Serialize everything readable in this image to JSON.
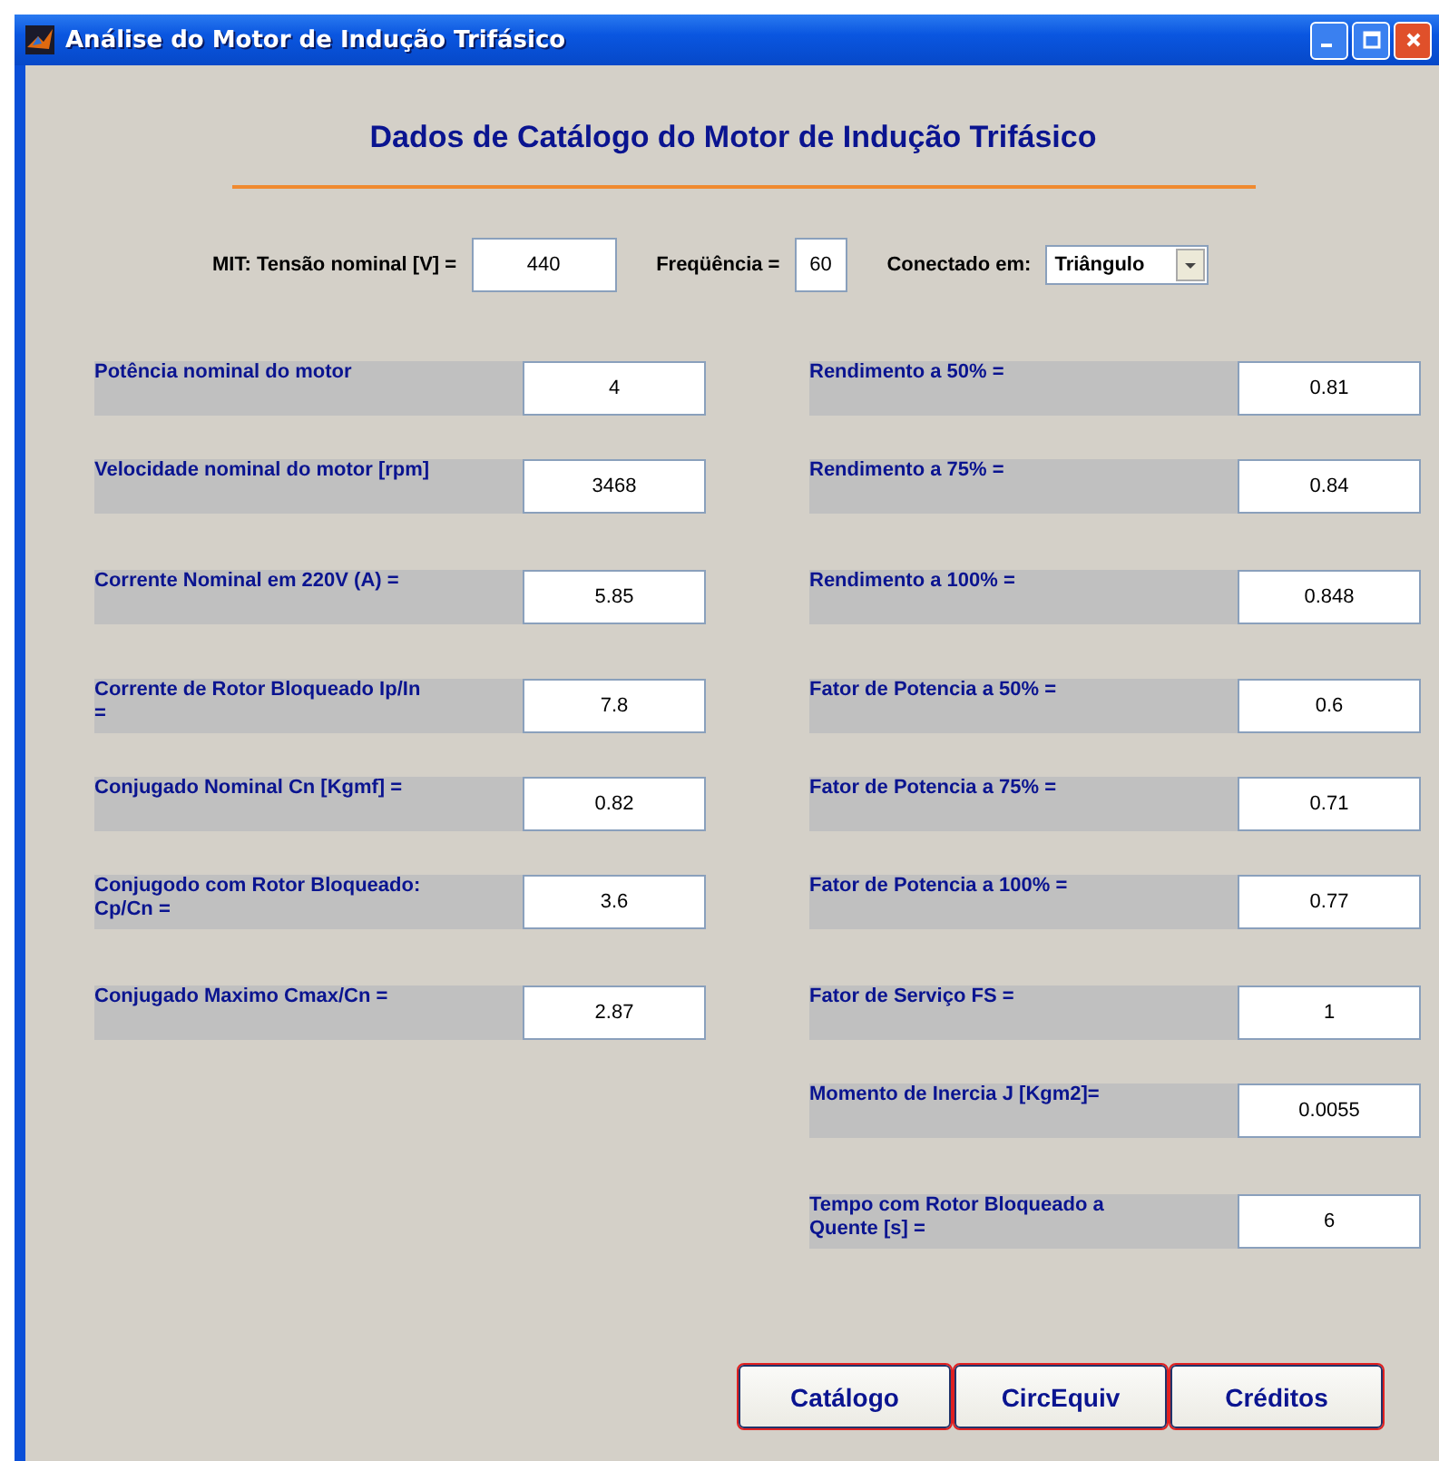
{
  "window": {
    "title": "Análise do Motor de Indução Trifásico"
  },
  "heading": "Dados de Catálogo do Motor de Indução Trifásico",
  "top_fields": [
    {
      "kind": "field",
      "label": "MIT: Tensão nominal [V]  =",
      "value": "440"
    },
    {
      "kind": "field",
      "label": "Freqüência  =",
      "value": "60"
    },
    {
      "kind": "dropdown",
      "label": "Conectado em:",
      "value": "Triângulo"
    }
  ],
  "left_params": [
    {
      "label": "Potência nominal do motor",
      "value": "4"
    },
    {
      "label": "Velocidade nominal do motor [rpm]",
      "value": "3468"
    },
    {
      "label": "Corrente Nominal em 220V (A) =",
      "value": "5.85"
    },
    {
      "label": "Corrente de Rotor Bloqueado Ip/In =",
      "value": "7.8"
    },
    {
      "label": "Conjugado Nominal Cn [Kgmf] =",
      "value": "0.82"
    },
    {
      "label": "Conjugodo com Rotor Bloqueado: Cp/Cn =",
      "value": "3.6"
    },
    {
      "label": "Conjugado Maximo Cmax/Cn =",
      "value": "2.87"
    }
  ],
  "right_params": [
    {
      "label": "Rendimento a 50% =",
      "value": "0.81"
    },
    {
      "label": "Rendimento a 75% =",
      "value": "0.84"
    },
    {
      "label": "Rendimento a 100% =",
      "value": "0.848"
    },
    {
      "label": "Fator de Potencia a 50% =",
      "value": "0.6"
    },
    {
      "label": "Fator de Potencia a 75% =",
      "value": "0.71"
    },
    {
      "label": "Fator de Potencia a 100% =",
      "value": "0.77"
    },
    {
      "label": "Fator de Serviço FS =",
      "value": "1"
    },
    {
      "label": "Momento de Inercia J [Kgm2]=",
      "value": "0.0055"
    },
    {
      "label": "Tempo com Rotor Bloqueado a Quente [s] =",
      "value": "6"
    }
  ],
  "buttons": [
    "Catálogo",
    "CircEquiv",
    "Créditos"
  ]
}
